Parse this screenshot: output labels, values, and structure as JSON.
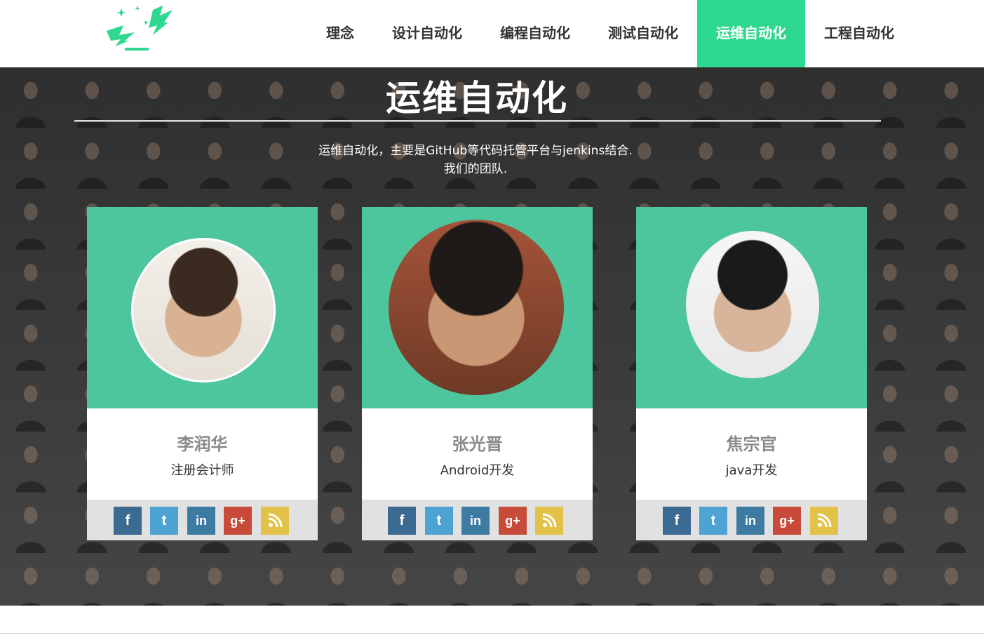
{
  "nav": {
    "items": [
      {
        "label": "理念"
      },
      {
        "label": "设计自动化"
      },
      {
        "label": "编程自动化"
      },
      {
        "label": "测试自动化"
      },
      {
        "label": "运维自动化",
        "active": true
      },
      {
        "label": "工程自动化"
      }
    ]
  },
  "hero": {
    "title": "运维自动化",
    "desc_line1": "运维自动化，主要是GitHub等代码托管平台与jenkins结合.",
    "desc_line2": "我们的团队."
  },
  "team": [
    {
      "name": "李润华",
      "role": "注册会计师"
    },
    {
      "name": "张光晋",
      "role": "Android开发"
    },
    {
      "name": "焦宗官",
      "role": "java开发"
    }
  ],
  "social_icons": [
    {
      "name": "facebook-icon",
      "glyph": "f"
    },
    {
      "name": "twitter-icon",
      "glyph": "t"
    },
    {
      "name": "linkedin-icon",
      "glyph": "in"
    },
    {
      "name": "google-plus-icon",
      "glyph": "g+"
    },
    {
      "name": "rss-icon",
      "glyph": "rss"
    }
  ],
  "colors": {
    "accent": "#2fd88f",
    "card_top": "#2fbc8c"
  }
}
